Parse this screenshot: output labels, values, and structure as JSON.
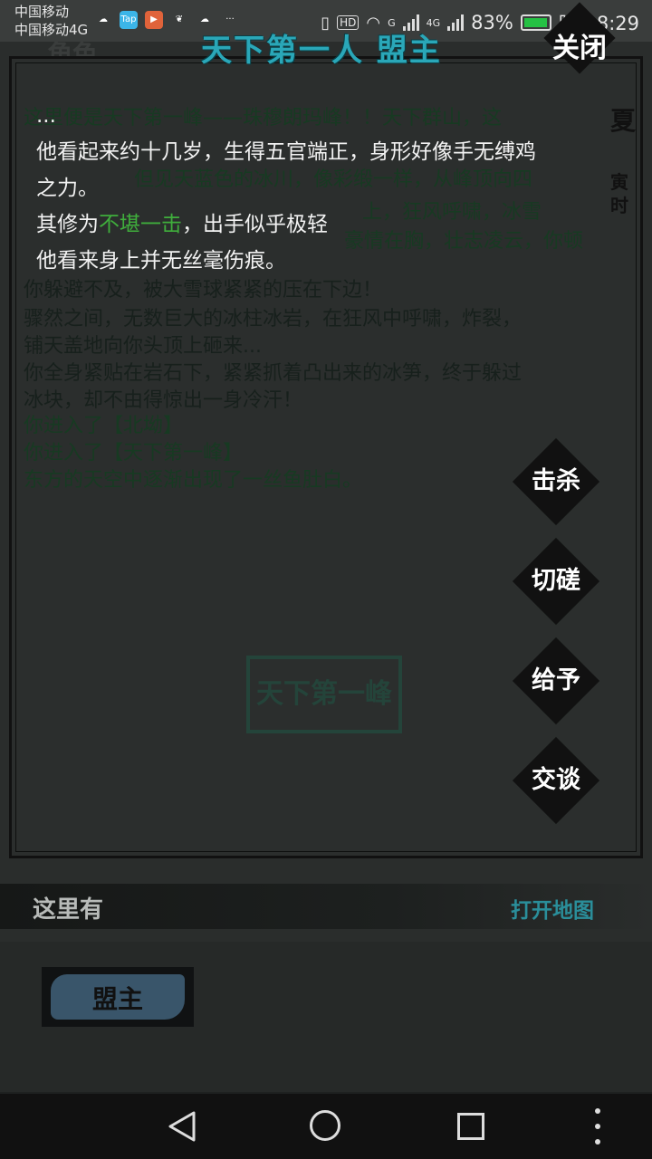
{
  "status_bar": {
    "carrier_1": "中国移动",
    "carrier_2": "中国移动4G",
    "app_icons": [
      "cloud-icon",
      "taptap-icon",
      "video-icon",
      "uc-browser-icon",
      "cloud-upload-icon",
      "more-dots-icon"
    ],
    "hd_badge": "HD",
    "net_g": "G",
    "net_4g": "4G",
    "battery_percent": "83%",
    "battery_level": 0.83,
    "time": "晚上8:29"
  },
  "background": {
    "tab_label": "角色",
    "season": "夏",
    "hour": "寅时",
    "lines": [
      {
        "text": "这里便是天下第一峰——珠穆朗玛峰！！天下群山，这",
        "green": true
      },
      {
        "text": "但见天蓝色的冰川，像彩缎一样，从峰顶向四",
        "green": true
      },
      {
        "text": "上，狂风呼啸，冰雪",
        "green": true
      },
      {
        "text": "豪情在胸，壮志凌云，你顿",
        "green": true
      },
      {
        "text": "你躲避不及，被大雪球紧紧的压在下边！",
        "green": false
      },
      {
        "text": "骤然之间，无数巨大的冰柱冰岩，在狂风中呼啸，炸裂，",
        "green": false
      },
      {
        "text": "铺天盖地向你头顶上砸来...",
        "green": false
      },
      {
        "text": "你全身紧贴在岩石下，紧紧抓着凸出来的冰笋，终于躲过",
        "green": false
      },
      {
        "text": "冰块，却不由得惊出一身冷汗！",
        "green": false
      },
      {
        "text": "你进入了【北坳】",
        "green": true
      },
      {
        "text": "你进入了【天下第一峰】",
        "green": true
      },
      {
        "text": "东方的天空中逐渐出现了一丝鱼肚白。",
        "green": true
      }
    ],
    "location_seal": "天下第一峰"
  },
  "dialog": {
    "title": "天下第一人 盟主",
    "close_label": "关闭",
    "desc_lines": [
      "...",
      "他看起来约十几岁，生得五官端正，身形好像手无缚鸡",
      "之力。"
    ],
    "skill_prefix": "其修为",
    "skill_level": "不堪一击",
    "skill_suffix": "，出手似乎极轻",
    "injury_line": "他看来身上并无丝毫伤痕。",
    "actions": [
      "击杀",
      "切磋",
      "给予",
      "交谈"
    ]
  },
  "bottom": {
    "here_label": "这里有",
    "map_link": "打开地图",
    "npc_name": "盟主"
  },
  "nav": [
    "back-icon",
    "home-icon",
    "recent-apps-icon",
    "menu-more-icon"
  ]
}
